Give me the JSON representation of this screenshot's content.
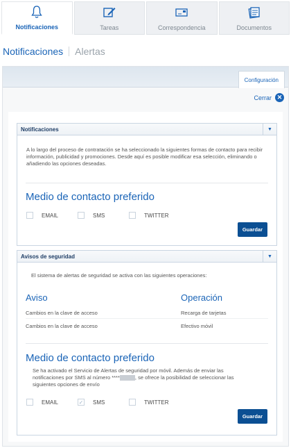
{
  "tabs": [
    {
      "label": "Notificaciones",
      "icon": "bell-icon",
      "active": true
    },
    {
      "label": "Tareas",
      "icon": "edit-icon",
      "active": false
    },
    {
      "label": "Correspondencia",
      "icon": "letter-icon",
      "active": false
    },
    {
      "label": "Documentos",
      "icon": "documents-icon",
      "active": false
    }
  ],
  "subnav": {
    "active": "Notificaciones",
    "other": "Alertas"
  },
  "panel": {
    "config_tab": "Configuración",
    "close_label": "Cerrar"
  },
  "notificaciones": {
    "title": "Notificaciones",
    "intro": "A lo largo del proceso de contratación se ha seleccionado la siguientes formas de contacto para recibir información, publicidad y promociones. Desde aquí es posible modificar esa selección, eliminando o añadiendo las opciones deseadas.",
    "medio_title": "Medio de contacto preferido",
    "options": [
      {
        "label": "EMAIL",
        "checked": false
      },
      {
        "label": "SMS",
        "checked": false
      },
      {
        "label": "TWITTER",
        "checked": false
      }
    ],
    "save_label": "Guardar"
  },
  "avisos": {
    "title": "Avisos de seguridad",
    "intro": "El sistema de alertas de seguridad se activa con las siguientes operaciones:",
    "col_aviso": "Aviso",
    "col_operacion": "Operación",
    "rows": [
      {
        "aviso": "Cambios en la clave de acceso",
        "operacion": "Recarga de tarjetas"
      },
      {
        "aviso": "Cambios en la clave de acceso",
        "operacion": "Efectivo móvil"
      }
    ],
    "medio_title": "Medio de contacto preferido",
    "text1": "Se ha activado el Servicio de Alertas de seguridad por móvil. Además de enviar las",
    "text2a": "notificaciones por SMS al número ****",
    "text2b": ", se ofrece la posibilidad de seleccionar las",
    "text3": "siguientes opciones de envío",
    "options": [
      {
        "label": "EMAIL",
        "checked": false
      },
      {
        "label": "SMS",
        "checked": true
      },
      {
        "label": "TWITTER",
        "checked": false
      }
    ],
    "save_label": "Guardar"
  }
}
